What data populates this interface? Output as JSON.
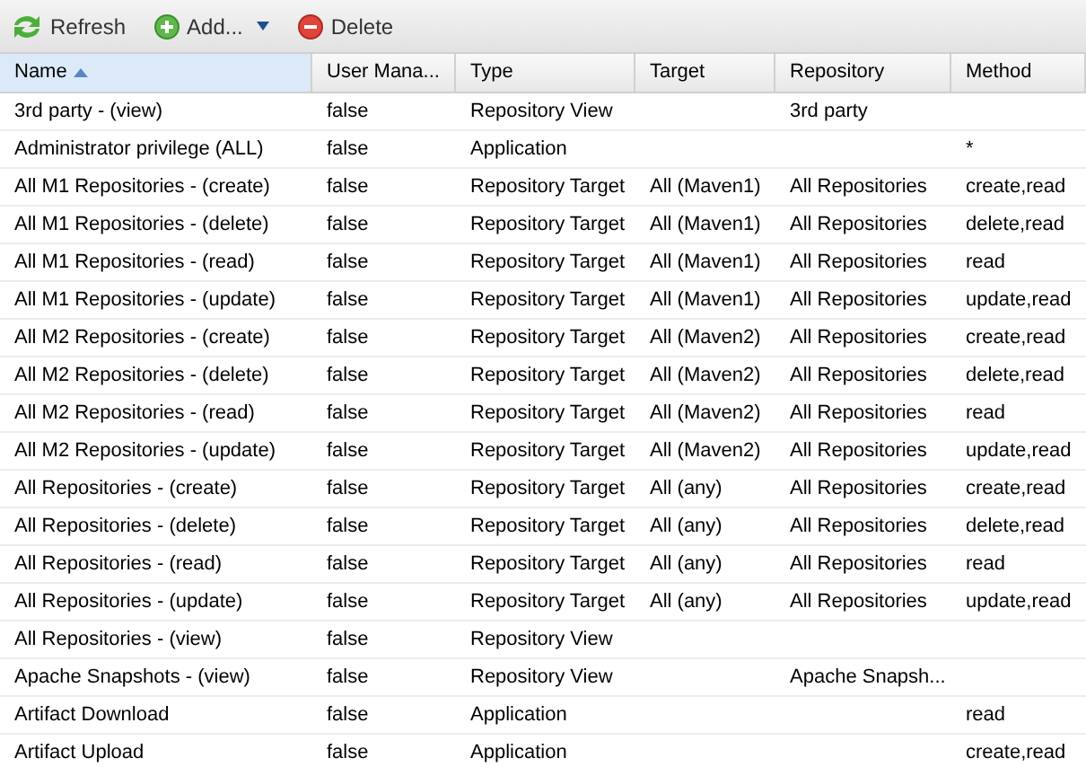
{
  "toolbar": [
    {
      "kind": "refresh",
      "label": "Refresh"
    },
    {
      "kind": "add",
      "label": "Add...",
      "menu": true
    },
    {
      "kind": "delete",
      "label": "Delete"
    }
  ],
  "table": {
    "columns": [
      {
        "label": "Name",
        "sorted": true
      },
      {
        "label": "User Mana...",
        "sorted": false
      },
      {
        "label": "Type",
        "sorted": false
      },
      {
        "label": "Target",
        "sorted": false
      },
      {
        "label": "Repository",
        "sorted": false
      },
      {
        "label": "Method",
        "sorted": false
      }
    ],
    "rows": [
      [
        "3rd party - (view)",
        "false",
        "Repository View",
        "",
        "3rd party",
        ""
      ],
      [
        "Administrator privilege (ALL)",
        "false",
        "Application",
        "",
        "",
        "*"
      ],
      [
        "All M1 Repositories - (create)",
        "false",
        "Repository Target",
        "All (Maven1)",
        "All Repositories",
        "create,read"
      ],
      [
        "All M1 Repositories - (delete)",
        "false",
        "Repository Target",
        "All (Maven1)",
        "All Repositories",
        "delete,read"
      ],
      [
        "All M1 Repositories - (read)",
        "false",
        "Repository Target",
        "All (Maven1)",
        "All Repositories",
        "read"
      ],
      [
        "All M1 Repositories - (update)",
        "false",
        "Repository Target",
        "All (Maven1)",
        "All Repositories",
        "update,read"
      ],
      [
        "All M2 Repositories - (create)",
        "false",
        "Repository Target",
        "All (Maven2)",
        "All Repositories",
        "create,read"
      ],
      [
        "All M2 Repositories - (delete)",
        "false",
        "Repository Target",
        "All (Maven2)",
        "All Repositories",
        "delete,read"
      ],
      [
        "All M2 Repositories - (read)",
        "false",
        "Repository Target",
        "All (Maven2)",
        "All Repositories",
        "read"
      ],
      [
        "All M2 Repositories - (update)",
        "false",
        "Repository Target",
        "All (Maven2)",
        "All Repositories",
        "update,read"
      ],
      [
        "All Repositories - (create)",
        "false",
        "Repository Target",
        "All (any)",
        "All Repositories",
        "create,read"
      ],
      [
        "All Repositories - (delete)",
        "false",
        "Repository Target",
        "All (any)",
        "All Repositories",
        "delete,read"
      ],
      [
        "All Repositories - (read)",
        "false",
        "Repository Target",
        "All (any)",
        "All Repositories",
        "read"
      ],
      [
        "All Repositories - (update)",
        "false",
        "Repository Target",
        "All (any)",
        "All Repositories",
        "update,read"
      ],
      [
        "All Repositories - (view)",
        "false",
        "Repository View",
        "",
        "",
        ""
      ],
      [
        "Apache Snapshots - (view)",
        "false",
        "Repository View",
        "",
        "Apache Snapsh...",
        ""
      ],
      [
        "Artifact Download",
        "false",
        "Application",
        "",
        "",
        "read"
      ],
      [
        "Artifact Upload",
        "false",
        "Application",
        "",
        "",
        "create,read"
      ]
    ]
  }
}
